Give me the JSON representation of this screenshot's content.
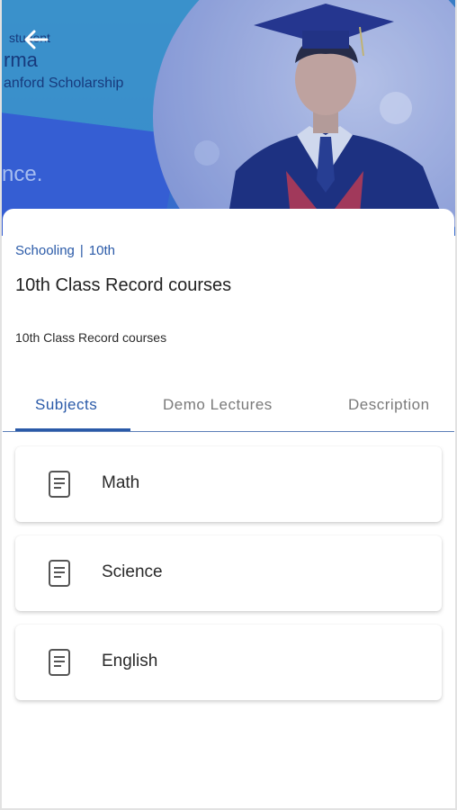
{
  "hero": {
    "line1": "student",
    "line2": "rma",
    "line3": "anford Scholarship",
    "line4": "nce."
  },
  "course": {
    "category": "Schooling",
    "separator": "|",
    "level": "10th",
    "title": "10th Class Record courses",
    "subtitle": "10th Class Record courses"
  },
  "tabs": [
    {
      "label": "Subjects",
      "active": true
    },
    {
      "label": "Demo Lectures",
      "active": false
    },
    {
      "label": "Description",
      "active": false
    }
  ],
  "subjects": [
    {
      "name": "Math",
      "icon": "document-icon"
    },
    {
      "name": "Science",
      "icon": "document-icon"
    },
    {
      "name": "English",
      "icon": "document-icon"
    }
  ],
  "colors": {
    "accent": "#2a5aa8",
    "hero_blue": "#2f5fc4",
    "text_dark": "#222222",
    "tab_inactive": "#7a7a7a"
  }
}
